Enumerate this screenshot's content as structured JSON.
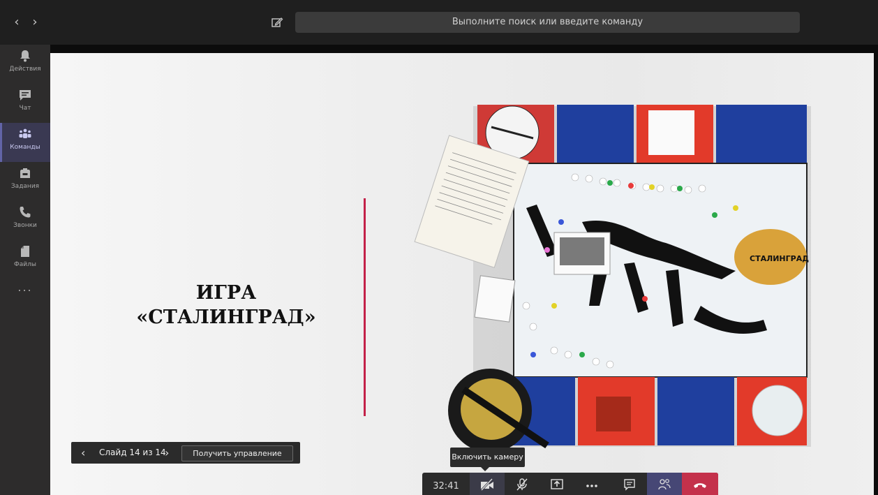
{
  "topbar": {
    "back_icon": "chevron-left-icon",
    "forward_icon": "chevron-right-icon",
    "compose_icon": "compose-icon",
    "search_placeholder": "Выполните поиск или введите команду"
  },
  "rail": {
    "items": [
      {
        "label": "Действия",
        "icon": "bell-icon"
      },
      {
        "label": "Чат",
        "icon": "chat-icon"
      },
      {
        "label": "Команды",
        "icon": "teams-icon",
        "active": true
      },
      {
        "label": "Задания",
        "icon": "backpack-icon"
      },
      {
        "label": "Звонки",
        "icon": "phone-icon"
      },
      {
        "label": "Файлы",
        "icon": "file-icon"
      }
    ],
    "more": "..."
  },
  "slide": {
    "title_line1": "ИГРА",
    "title_line2": "«СТАЛИНГРАД»",
    "board_label": "СТАЛИНГРАД",
    "accent_color": "#c32148"
  },
  "slide_controls": {
    "counter": "Слайд 14 из 14",
    "take_control": "Получить управление"
  },
  "tooltip": "Включить камеру",
  "callbar": {
    "timer": "32:41",
    "buttons": [
      "camera-off-icon",
      "mic-off-icon",
      "share-screen-icon",
      "more-icon",
      "chat-icon",
      "participants-icon",
      "hang-up-icon"
    ]
  },
  "colors": {
    "brand": "#6264a7",
    "hangup": "#c4314b",
    "participants_bg": "#464775"
  }
}
